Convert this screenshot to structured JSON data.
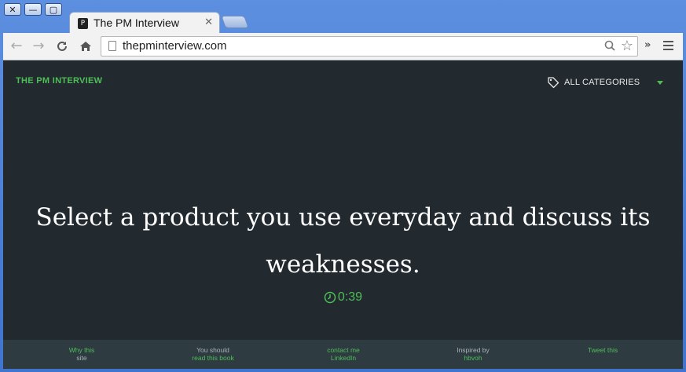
{
  "browser": {
    "window_controls": [
      "✕",
      "—",
      "▢"
    ],
    "tab": {
      "title": "The PM Interview",
      "close": "✕"
    },
    "url": "thepminterview.com"
  },
  "header": {
    "brand": "THE PM INTERVIEW",
    "categories_label": "ALL CATEGORIES"
  },
  "main": {
    "question": "Select a product you use everyday and discuss its weaknesses.",
    "timer": "0:39"
  },
  "footer": {
    "links": [
      {
        "line1": "Why this",
        "line2": "site"
      },
      {
        "line1": "You should",
        "line2": "read this book"
      },
      {
        "line1": "contact me",
        "line2": "LinkedIn"
      },
      {
        "line1": "Inspired by",
        "line2": "hbvoh"
      },
      {
        "line1": "",
        "line2": "Tweet this"
      }
    ]
  },
  "colors": {
    "accent": "#4fbe57",
    "page_bg": "#222a30",
    "footer_bg": "#2e3b41"
  },
  "icons": [
    "close-icon",
    "minimize-icon",
    "maximize-icon",
    "back-arrow-icon",
    "forward-arrow-icon",
    "reload-icon",
    "home-icon",
    "page-icon",
    "search-icon",
    "star-icon",
    "chevron-right-icon",
    "menu-icon",
    "tag-icon",
    "caret-down-icon",
    "clock-icon"
  ]
}
